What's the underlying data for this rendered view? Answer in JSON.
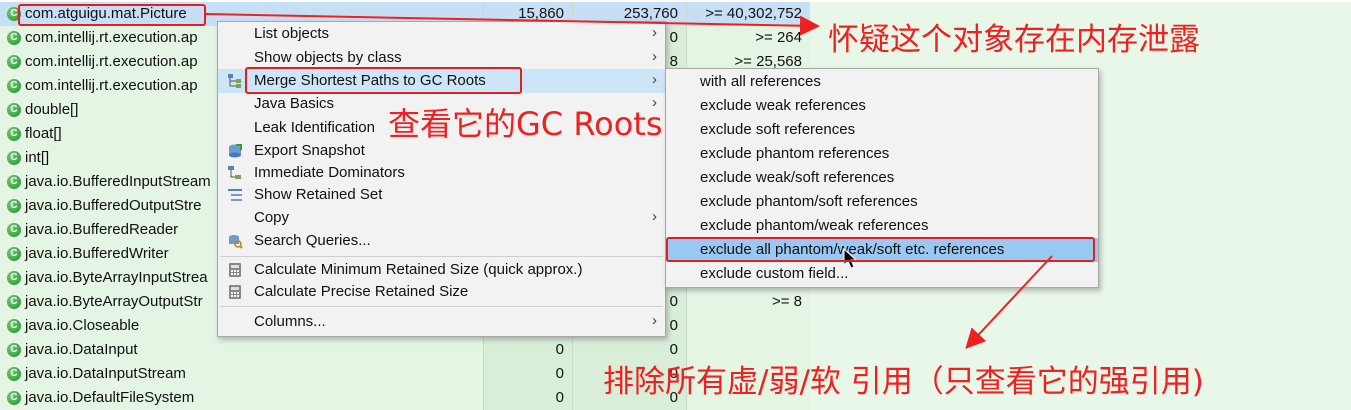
{
  "table": {
    "rows": [
      {
        "name": "com.atguigu.mat.Picture",
        "objects": "15,860",
        "shallow": "253,760",
        "retained": ">= 40,302,752",
        "selected": true
      },
      {
        "name": "com.intellij.rt.execution.ap",
        "objects": "",
        "shallow": "0",
        "retained": ">= 264"
      },
      {
        "name": "com.intellij.rt.execution.ap",
        "objects": "",
        "shallow": "8",
        "retained": ">= 25,568"
      },
      {
        "name": "com.intellij.rt.execution.ap",
        "objects": "",
        "shallow": "",
        "retained": ""
      },
      {
        "name": "double[]",
        "objects": "",
        "shallow": "",
        "retained": ""
      },
      {
        "name": "float[]",
        "objects": "",
        "shallow": "",
        "retained": ""
      },
      {
        "name": "int[]",
        "objects": "",
        "shallow": "",
        "retained": ""
      },
      {
        "name": "java.io.BufferedInputStream",
        "objects": "",
        "shallow": "",
        "retained": ""
      },
      {
        "name": "java.io.BufferedOutputStre",
        "objects": "",
        "shallow": "",
        "retained": ""
      },
      {
        "name": "java.io.BufferedReader",
        "objects": "",
        "shallow": "",
        "retained": ""
      },
      {
        "name": "java.io.BufferedWriter",
        "objects": "",
        "shallow": "",
        "retained": ""
      },
      {
        "name": "java.io.ByteArrayInputStrea",
        "objects": "",
        "shallow": "",
        "retained": ""
      },
      {
        "name": "java.io.ByteArrayOutputStr",
        "objects": "",
        "shallow": "0",
        "retained": ">= 8"
      },
      {
        "name": "java.io.Closeable",
        "objects": "",
        "shallow": "0",
        "retained": ""
      },
      {
        "name": "java.io.DataInput",
        "objects": "0",
        "shallow": "0",
        "retained": ""
      },
      {
        "name": "java.io.DataInputStream",
        "objects": "0",
        "shallow": "0",
        "retained": ""
      },
      {
        "name": "java.io.DefaultFileSystem",
        "objects": "0",
        "shallow": "0",
        "retained": ""
      }
    ]
  },
  "context_menu": {
    "items": [
      {
        "label": "List objects",
        "arrow": "›",
        "icon": ""
      },
      {
        "label": "Show objects by class",
        "arrow": "›",
        "icon": ""
      },
      {
        "label": "Merge Shortest Paths to GC Roots",
        "arrow": "›",
        "icon": "merge-paths-icon"
      },
      {
        "label": "Java Basics",
        "arrow": "›",
        "icon": ""
      },
      {
        "label": "Leak Identification",
        "arrow": "",
        "icon": ""
      },
      {
        "label": "Export Snapshot",
        "arrow": "",
        "icon": "export-snapshot-icon"
      },
      {
        "label": "Immediate Dominators",
        "arrow": "",
        "icon": "dominators-icon"
      },
      {
        "label": "Show Retained Set",
        "arrow": "",
        "icon": "retained-set-icon"
      },
      {
        "label": "Copy",
        "arrow": "›",
        "icon": ""
      },
      {
        "label": "Search Queries...",
        "arrow": "",
        "icon": "search-queries-icon"
      },
      {
        "label": "Calculate Minimum Retained Size (quick approx.)",
        "arrow": "",
        "icon": "calculator-icon"
      },
      {
        "label": "Calculate Precise Retained Size",
        "arrow": "",
        "icon": "calculator-icon"
      },
      {
        "label": "Columns...",
        "arrow": "›",
        "icon": ""
      }
    ]
  },
  "submenu": {
    "items": [
      "with all references",
      "exclude weak references",
      "exclude soft references",
      "exclude phantom references",
      "exclude weak/soft references",
      "exclude phantom/soft references",
      "exclude phantom/weak references",
      "exclude all phantom/weak/soft etc. references",
      "exclude custom field..."
    ]
  },
  "annotations": {
    "suspect_leak": "怀疑这个对象存在内存泄露",
    "view_gc_roots": "查看它的GC Roots",
    "exclude_refs": "排除所有虚/弱/软 引用（只查看它的强引用)"
  },
  "colors": {
    "annotation_red": "#f02020",
    "row_selected": "#c7dff5",
    "row_bg": "#e4f5e4",
    "submenu_highlight": "#99c9f3"
  }
}
